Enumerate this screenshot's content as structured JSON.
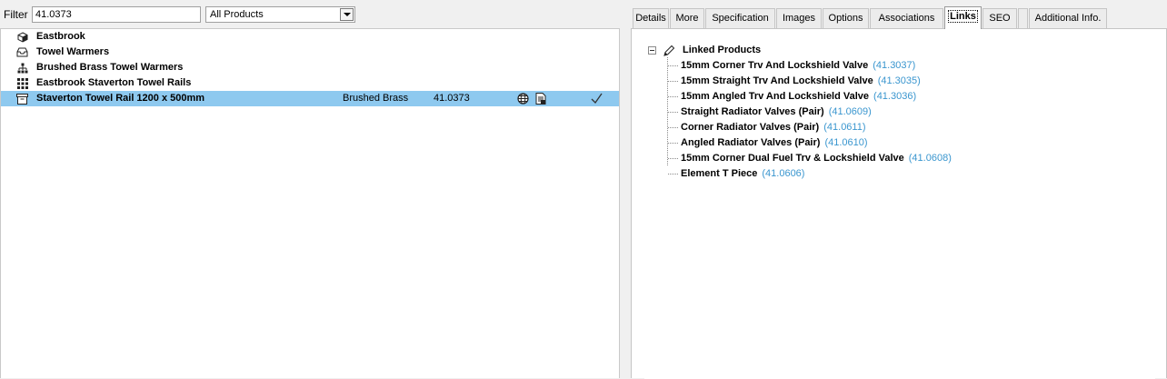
{
  "filter": {
    "label": "Filter",
    "value": "41.0373",
    "scope": "All Products"
  },
  "tree": {
    "rows": [
      {
        "label": "Eastbrook",
        "icon": "cube-icon"
      },
      {
        "label": "Towel Warmers",
        "icon": "tray-icon"
      },
      {
        "label": "Brushed Brass Towel Warmers",
        "icon": "hierarchy-icon"
      },
      {
        "label": "Eastbrook Staverton Towel Rails",
        "icon": "grid-icon"
      },
      {
        "label": "Staverton Towel Rail 1200 x 500mm",
        "icon": "box-icon",
        "finish": "Brushed Brass",
        "code": "41.0373",
        "selected": true
      }
    ],
    "selected_color": "#8ec9ef"
  },
  "tabs": [
    {
      "label": "Details"
    },
    {
      "label": "More"
    },
    {
      "label": "Specification"
    },
    {
      "label": "Images"
    },
    {
      "label": "Options"
    },
    {
      "label": "Associations"
    },
    {
      "label": "Links",
      "active": true
    },
    {
      "label": "SEO"
    },
    {
      "label": ""
    },
    {
      "label": "Additional Info."
    }
  ],
  "links": {
    "root_label": "Linked Products",
    "code_color": "#3a96cf",
    "items": [
      {
        "name": "15mm Corner Trv And Lockshield Valve",
        "code": "(41.3037)"
      },
      {
        "name": "15mm Straight Trv And Lockshield Valve",
        "code": "(41.3035)"
      },
      {
        "name": "15mm Angled Trv And Lockshield Valve",
        "code": "(41.3036)"
      },
      {
        "name": "Straight Radiator Valves (Pair)",
        "code": "(41.0609)"
      },
      {
        "name": "Corner Radiator Valves (Pair)",
        "code": "(41.0611)"
      },
      {
        "name": "Angled Radiator Valves (Pair)",
        "code": "(41.0610)"
      },
      {
        "name": "15mm Corner Dual Fuel Trv & Lockshield Valve",
        "code": "(41.0608)"
      },
      {
        "name": "Element T Piece",
        "code": "(41.0606)"
      }
    ]
  }
}
